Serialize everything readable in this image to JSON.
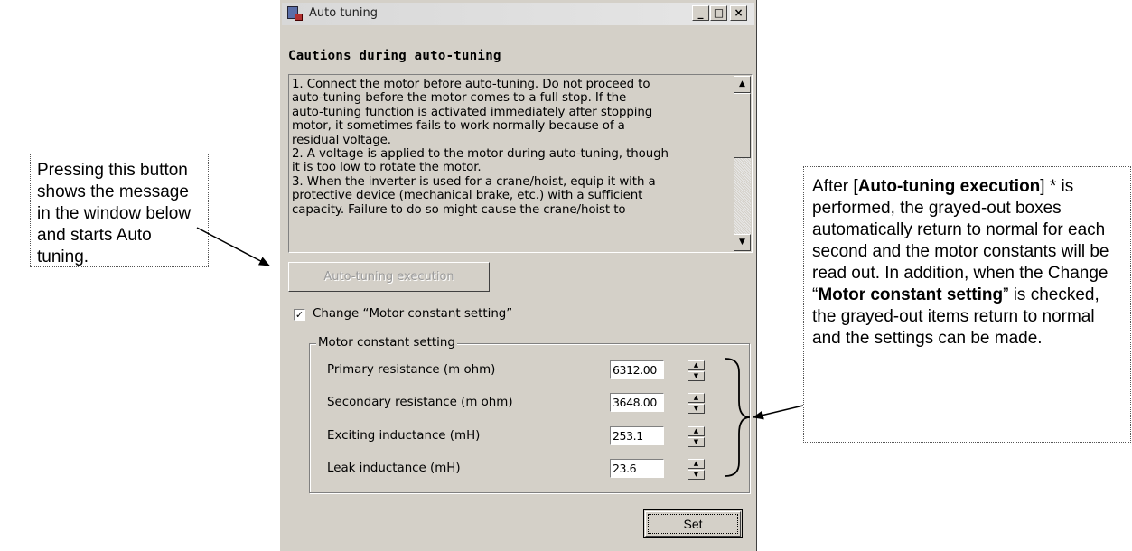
{
  "window": {
    "title": "Auto tuning",
    "minimize": "_",
    "maximize": "□",
    "close": "×"
  },
  "cautions": {
    "heading": "Cautions during auto-tuning",
    "lines": [
      "1. Connect the motor before auto-tuning. Do not proceed to",
      "auto-tuning before the motor comes to a full stop. If the",
      "auto-tuning function is activated immediately after stopping",
      "motor, it sometimes fails to work normally because of a",
      "residual voltage.",
      "2. A voltage is applied to the motor during auto-tuning, though",
      "it is too low to rotate the motor.",
      "3. When the inverter is used for a crane/hoist, equip it with a",
      "protective device (mechanical brake, etc.) with a sufficient",
      "capacity. Failure to do so might cause the crane/hoist to"
    ]
  },
  "execute_button": "Auto-tuning execution",
  "change_checkbox": {
    "checked": true,
    "label": "Change “Motor constant setting”"
  },
  "motor_constant": {
    "legend": "Motor constant setting",
    "params": [
      {
        "label": "Primary resistance (m ohm)",
        "value": "6312.00"
      },
      {
        "label": "Secondary resistance (m ohm)",
        "value": "3648.00"
      },
      {
        "label": "Exciting inductance (mH)",
        "value": "253.1"
      },
      {
        "label": "Leak inductance (mH)",
        "value": "23.6"
      }
    ]
  },
  "set_button": "Set",
  "callouts": {
    "left": [
      "Pressing this button",
      "shows the message",
      "in the window below",
      "and starts Auto",
      "tuning."
    ],
    "right": {
      "prefix": "After [",
      "bold1": "Auto-tuning execution",
      "middle": "] * is performed, the grayed-out boxes automatically return to normal for each second and the motor constants will be read out. In addition, when the Change “",
      "bold2": "Motor constant setting",
      "suffix": "” is checked, the grayed-out items return to normal and the settings can be made."
    }
  }
}
